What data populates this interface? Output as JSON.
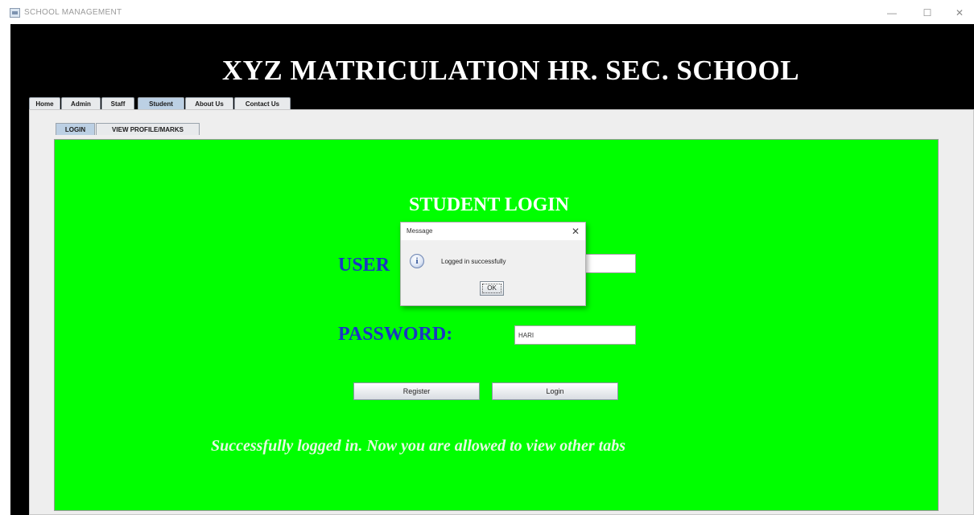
{
  "window": {
    "title": "SCHOOL MANAGEMENT",
    "controls": {
      "minimize": "—",
      "maximize": "☐",
      "close": "✕"
    }
  },
  "header": {
    "title": "XYZ MATRICULATION HR. SEC. SCHOOL"
  },
  "main_tabs": [
    {
      "label": "Home"
    },
    {
      "label": "Admin"
    },
    {
      "label": "Staff"
    },
    {
      "label": "Student",
      "selected": true
    },
    {
      "label": "About Us"
    },
    {
      "label": "Contact Us"
    }
  ],
  "sub_tabs": [
    {
      "label": "LOGIN",
      "selected": true
    },
    {
      "label": "VIEW PROFILE/MARKS"
    }
  ],
  "login": {
    "heading": "STUDENT LOGIN",
    "user_label": "USER",
    "password_label": "PASSWORD:",
    "user_value": "",
    "password_value": "HARI",
    "register_button": "Register",
    "login_button": "Login",
    "success_message": "Successfully logged in. Now you are allowed to view other tabs",
    "panel_color": "#00ff00",
    "label_color": "#1b35c4"
  },
  "dialog": {
    "title": "Message",
    "close": "✕",
    "icon": "info-icon",
    "icon_glyph": "i",
    "message": "Logged in successfully",
    "ok_button": "OK"
  }
}
